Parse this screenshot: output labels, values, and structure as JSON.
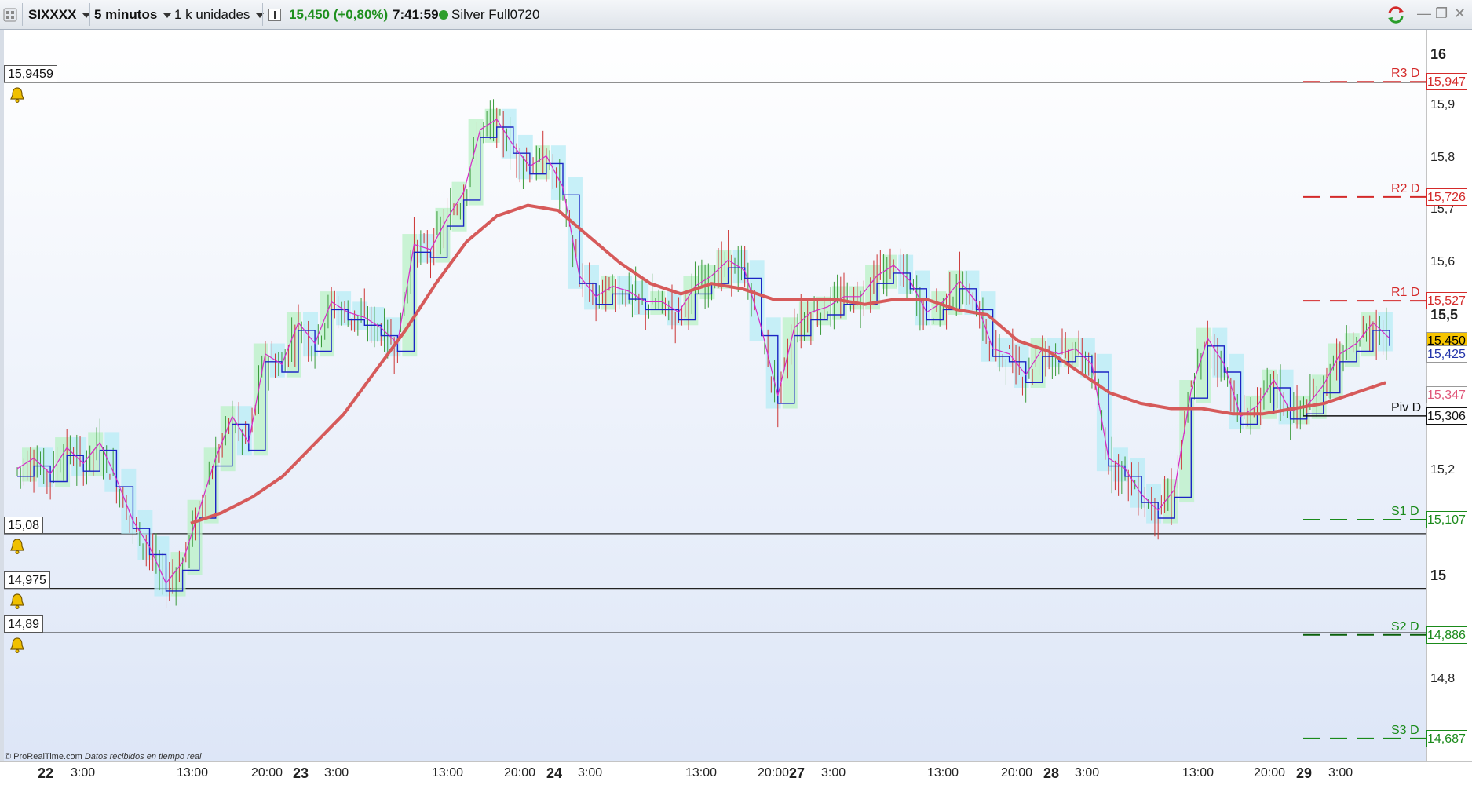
{
  "toolbar": {
    "ticker": "SIXXXX",
    "timeframe": "5 minutos",
    "units": "1 k unidades",
    "price_change": "15,450 (+0,80%)",
    "time": "7:41:59",
    "instrument": "Silver Full0720",
    "status_color": "#2e9e2e",
    "change_color": "#1e8f1e"
  },
  "price_axis": {
    "ticks": [
      {
        "label": "16",
        "value": 16,
        "bold": true
      },
      {
        "label": "15,9",
        "value": 15.9
      },
      {
        "label": "15,8",
        "value": 15.8
      },
      {
        "label": "15,7",
        "value": 15.7
      },
      {
        "label": "15,6",
        "value": 15.6
      },
      {
        "label": "15,5",
        "value": 15.5,
        "bold": true
      },
      {
        "label": "15,2",
        "value": 15.2
      },
      {
        "label": "15",
        "value": 15,
        "bold": true
      },
      {
        "label": "14,8",
        "value": 14.8
      }
    ]
  },
  "alert_levels": [
    {
      "label": "15,9459",
      "value": 15.9459
    },
    {
      "label": "15,08",
      "value": 15.08
    },
    {
      "label": "14,975",
      "value": 14.975
    },
    {
      "label": "14,89",
      "value": 14.89
    }
  ],
  "pivots": [
    {
      "name": "R3 D",
      "label": "15,947",
      "value": 15.947,
      "color": "#d42a2a",
      "line_color": "#d42a2a",
      "style": "dashed",
      "highlight": "#ffffff"
    },
    {
      "name": "R2 D",
      "label": "15,726",
      "value": 15.726,
      "color": "#d42a2a",
      "line_color": "#d42a2a",
      "style": "dashed",
      "highlight": "#ffffff"
    },
    {
      "name": "R1 D",
      "label": "15,527",
      "value": 15.527,
      "color": "#d42a2a",
      "line_color": "#d42a2a",
      "style": "dashed",
      "highlight": "#ffffff"
    },
    {
      "name": "Piv D",
      "label": "15,306",
      "value": 15.306,
      "color": "#111111",
      "line_color": "#111111",
      "style": "solid",
      "highlight": "#ffffff"
    },
    {
      "name": "S1 D",
      "label": "15,107",
      "value": 15.107,
      "color": "#1a8a1a",
      "line_color": "#1a8a1a",
      "style": "dashed",
      "highlight": "#ffffff"
    },
    {
      "name": "S2 D",
      "label": "14,886",
      "value": 14.886,
      "color": "#1a8a1a",
      "line_color": "#0a5f0a",
      "style": "dashed",
      "highlight": "#ffffff"
    },
    {
      "name": "S3 D",
      "label": "14,687",
      "value": 14.687,
      "color": "#1a8a1a",
      "line_color": "#1a8a1a",
      "style": "dashed",
      "highlight": "#ffffff"
    }
  ],
  "price_tags": [
    {
      "label": "15,450",
      "value": 15.45,
      "bg": "#f6c400",
      "color": "#000000"
    },
    {
      "label": "15,347",
      "value": 15.347,
      "bg": "#ffffff",
      "color": "#e0577a"
    },
    {
      "label": "15,425",
      "value": 15.425,
      "bg": "#ffffff",
      "color": "#2233aa"
    }
  ],
  "x_axis": {
    "labels": [
      {
        "label": "22",
        "day": true
      },
      {
        "label": "3:00"
      },
      {
        "label": "13:00"
      },
      {
        "label": "20:00"
      },
      {
        "label": "23",
        "day": true
      },
      {
        "label": "3:00"
      },
      {
        "label": "13:00"
      },
      {
        "label": "20:00"
      },
      {
        "label": "24",
        "day": true
      },
      {
        "label": "3:00"
      },
      {
        "label": "13:00"
      },
      {
        "label": "20:00"
      },
      {
        "label": "27",
        "day": true
      },
      {
        "label": "3:00"
      },
      {
        "label": "13:00"
      },
      {
        "label": "20:00"
      },
      {
        "label": "28",
        "day": true
      },
      {
        "label": "3:00"
      },
      {
        "label": "13:00"
      },
      {
        "label": "20:00"
      },
      {
        "label": "29",
        "day": true
      },
      {
        "label": "3:00"
      }
    ]
  },
  "footer": {
    "credit": "© ProRealTime.com",
    "realtime": "Datos recibidos en tiempo real"
  },
  "chart_data": {
    "type": "line",
    "ylim": [
      14.65,
      16.05
    ],
    "series": [
      {
        "values": [
          15.2,
          15.22,
          15.19,
          15.24,
          15.21,
          15.25,
          15.18,
          15.1,
          15.05,
          14.98,
          15.02,
          15.12,
          15.22,
          15.3,
          15.25,
          15.42,
          15.4,
          15.48,
          15.44,
          15.52,
          15.5,
          15.49,
          15.47,
          15.44,
          15.63,
          15.62,
          15.68,
          15.73,
          15.85,
          15.87,
          15.82,
          15.78,
          15.8,
          15.74,
          15.57,
          15.53,
          15.55,
          15.54,
          15.52,
          15.52,
          15.5,
          15.55,
          15.57,
          15.6,
          15.58,
          15.47,
          15.34,
          15.47,
          15.5,
          15.51,
          15.53,
          15.53,
          15.57,
          15.59,
          15.56,
          15.5,
          15.52,
          15.56,
          15.52,
          15.43,
          15.42,
          15.38,
          15.43,
          15.42,
          15.43,
          15.4,
          15.22,
          15.2,
          15.15,
          15.12,
          15.16,
          15.35,
          15.45,
          15.4,
          15.3,
          15.32,
          15.37,
          15.31,
          15.32,
          15.36,
          15.42,
          15.44,
          15.48,
          15.45
        ]
      },
      {
        "values": [
          15.1,
          15.12,
          15.15,
          15.19,
          15.25,
          15.31,
          15.39,
          15.47,
          15.56,
          15.64,
          15.69,
          15.71,
          15.7,
          15.65,
          15.6,
          15.56,
          15.54,
          15.56,
          15.55,
          15.53,
          15.53,
          15.53,
          15.52,
          15.53,
          15.53,
          15.51,
          15.5,
          15.45,
          15.43,
          15.39,
          15.35,
          15.33,
          15.32,
          15.32,
          15.31,
          15.31,
          15.32,
          15.33,
          15.35,
          15.37
        ]
      }
    ]
  }
}
